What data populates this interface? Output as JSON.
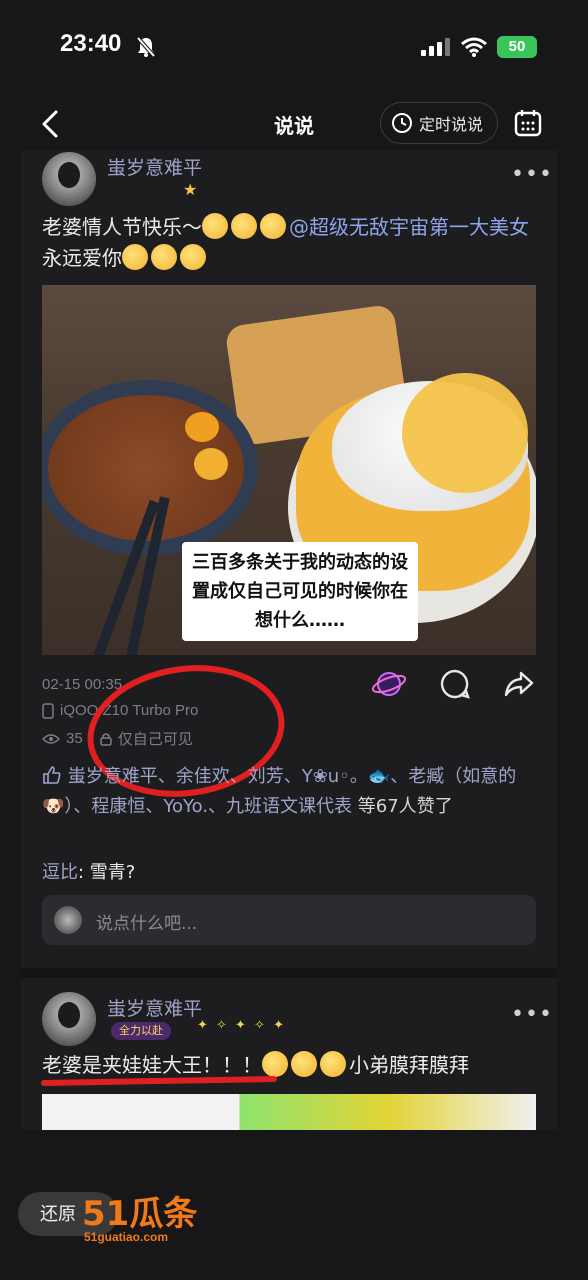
{
  "status_bar": {
    "time": "23:40",
    "battery": "50"
  },
  "nav": {
    "title": "说说",
    "timed_post_label": "定时说说"
  },
  "post1": {
    "username": "蚩岁意难平",
    "text_pre": "老婆情人节快乐～",
    "mention": "@超级无敌宇宙第一大美女",
    "text_post": "永远爱你",
    "image_caption": "三百多条关于我的动态的设置成仅自己可见的时候你在想什么……",
    "date": "02-15 00:35",
    "device": "iQOO Z10 Turbo Pro",
    "views": "35",
    "visibility": "仅自己可见",
    "likes_names": "蚩岁意难平、余佳欢、刘芳、Y❀u◦。🐟、老臧（如意的🐶）、程康恒、YoYo.、九班语文课代表",
    "likes_suffix": "等67人赞了",
    "comment_author": "逗比",
    "comment_text": "雪青?",
    "comment_placeholder": "说点什么吧..."
  },
  "post2": {
    "username": "蚩岁意难平",
    "badge": "全力以赴",
    "text_pre": "老婆是夹娃娃大王！！！",
    "text_post": "小弟膜拜膜拜"
  },
  "watermark": {
    "restore": "还原",
    "logo": "51瓜条",
    "url": "51guatiao.com"
  },
  "colors": {
    "background": "#171719",
    "card": "#1d1d20",
    "username": "#9fa3c8",
    "mention": "#8fa5e8",
    "annotation": "#e02020",
    "battery": "#39c55a"
  },
  "icons": [
    "bell-slash-icon",
    "signal-icon",
    "wifi-icon",
    "back-icon",
    "clock-icon",
    "calendar-icon",
    "more-icon",
    "phone-icon",
    "eye-icon",
    "lock-icon",
    "planet-icon",
    "comment-icon",
    "share-icon",
    "thumbs-up-icon"
  ]
}
